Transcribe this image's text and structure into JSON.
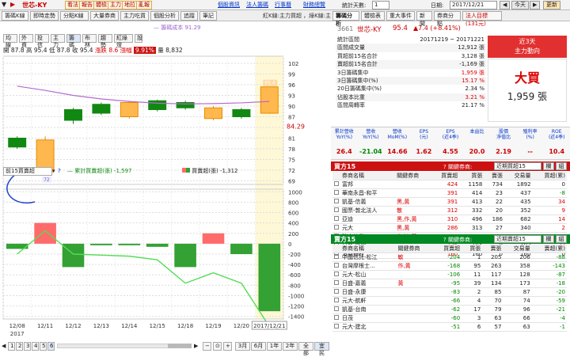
{
  "topbar": {
    "stock": "世芯-KY",
    "buttons": [
      "看法",
      "報告",
      "體檢",
      "主力",
      "地拉",
      "亂報"
    ],
    "links": [
      "個股資訊",
      "法人籌碼",
      "行事曆",
      "財務總覽"
    ],
    "period_label": "統計天數:",
    "period_value": "1",
    "date_label": "日期:",
    "date_value": "2017/12/21",
    "today_btn": "今天",
    "refresh_btn": "更新"
  },
  "left_tabs": [
    "籌碼K線",
    "即時走勢",
    "分點K線",
    "大量券商",
    "主力吃貨",
    "個股分析",
    "追蹤",
    "筆記"
  ],
  "left_note": "紅K線:主力買超 ，綠K線:主力賣超",
  "ind_tabs": [
    "均線",
    "外資",
    "投信",
    "主力",
    "籌碼",
    "布林",
    "趨勢",
    "紅綠燈",
    "設"
  ],
  "ind_active": "籌碼",
  "ohlc": {
    "open_l": "開",
    "open": "87.8",
    "high_l": "高",
    "high": "95.4",
    "low_l": "低",
    "low": "87.8",
    "close_l": "收",
    "close": "95.4",
    "chg_l": "漲跌",
    "chg": "8.6",
    "pct_l": "漲幅",
    "pct": "9.91%",
    "vol_l": "量",
    "vol": "8,832"
  },
  "ma_label": "— 籌碼成本 91.29",
  "price_axis": [
    "102",
    "99",
    "96",
    "93",
    "90",
    "87",
    "84",
    "81",
    "78",
    "75",
    "72",
    "69"
  ],
  "price_axis_vals": [
    102,
    99,
    96,
    93,
    90,
    87,
    84,
    81,
    78,
    75,
    72,
    69
  ],
  "last_price": "84.29",
  "last_tag": "95.4",
  "low_tag": "72",
  "broker_select": "前15買賣超",
  "legend1": "— 累計買賣超(張) -1,597",
  "legend2": "買賣超(張) -1,312",
  "vol_axis": [
    "1000",
    "800",
    "600",
    "400",
    "200",
    "0",
    "-200",
    "-400",
    "-600",
    "-800",
    "-1000",
    "-1200",
    "-1400"
  ],
  "vol_axis_vals": [
    1000,
    800,
    600,
    400,
    200,
    0,
    -200,
    -400,
    -600,
    -800,
    -1000,
    -1200,
    -1400
  ],
  "x_labels": [
    "12/08",
    "12/11",
    "12/12",
    "12/13",
    "12/14",
    "12/15",
    "12/18",
    "12/19",
    "12/20",
    "2017/12/21"
  ],
  "x_year": "2017",
  "bottom_pages": [
    "1",
    "2",
    "3",
    "4",
    "5",
    "6"
  ],
  "bottom_active": "6",
  "bottom_ranges": [
    "3月",
    "6月",
    "1年",
    "2年",
    "全部",
    "宜民"
  ],
  "candles": [
    {
      "o": 78.5,
      "c": 81.0,
      "h": 81.5,
      "l": 78.0,
      "up": false
    },
    {
      "o": 71.5,
      "c": 80.5,
      "h": 81.5,
      "l": 70.5,
      "up": true
    },
    {
      "o": 86.0,
      "c": 89.0,
      "h": 89.5,
      "l": 85.0,
      "up": false
    },
    {
      "o": 90.5,
      "c": 88.0,
      "h": 91.0,
      "l": 87.5,
      "up": false
    },
    {
      "o": 91.0,
      "c": 87.0,
      "h": 91.5,
      "l": 86.5,
      "up": true
    },
    {
      "o": 89.0,
      "c": 91.5,
      "h": 91.8,
      "l": 88.5,
      "up": false
    },
    {
      "o": 89.5,
      "c": 91.0,
      "h": 91.5,
      "l": 89.0,
      "up": false
    },
    {
      "o": 86.5,
      "c": 89.5,
      "h": 90.0,
      "l": 86.0,
      "up": true
    },
    {
      "o": 87.0,
      "c": 89.0,
      "h": 89.5,
      "l": 86.5,
      "up": false
    },
    {
      "o": 88.0,
      "c": 95.4,
      "h": 95.4,
      "l": 87.8,
      "up": true
    }
  ],
  "ma_series": [
    95.6,
    94.4,
    93.0,
    92.0,
    91.3,
    90.8,
    90.6,
    90.7,
    90.9,
    91.3
  ],
  "bars": [
    -100,
    400,
    -450,
    -30,
    -30,
    -60,
    -450,
    200,
    -200,
    -1300
  ],
  "cum_line": [
    -200,
    250,
    -200,
    -220,
    -240,
    -310,
    -760,
    -560,
    -760,
    -1597
  ],
  "right_tabs": [
    "籌碼分析",
    "體檢表",
    "重大事件",
    "新聞",
    "券商分點",
    "法人目標(131元)"
  ],
  "r_stock": {
    "code": "3661",
    "name": "世芯-KY",
    "price": "95.4",
    "chg": "▲7.4 (+8.41%)"
  },
  "stats": [
    {
      "k": "統計區間",
      "v": "20171219 ~ 20171221",
      "cls": ""
    },
    {
      "k": "區間成交量",
      "v": "12,912 張",
      "cls": ""
    },
    {
      "k": "買超前15名合計",
      "v": "3,128 張",
      "cls": ""
    },
    {
      "k": "賣超前15名合計",
      "v": "-1,169 張",
      "cls": ""
    },
    {
      "k": "3日籌碼集中",
      "v": "1,959 張",
      "cls": "red"
    },
    {
      "k": "3日籌碼集中(%)",
      "v": "15.17 %",
      "cls": "red"
    },
    {
      "k": "20日籌碼集中(%)",
      "v": "2.34 %",
      "cls": ""
    },
    {
      "k": "佔股本比重",
      "v": "3.21 %",
      "cls": "red"
    },
    {
      "k": "區間周轉率",
      "v": "21.17 %",
      "cls": ""
    }
  ],
  "trend": {
    "head1": "近3天",
    "head2": "主力動向",
    "big": "大買",
    "amt": "1,959 張"
  },
  "fin_head": [
    "累計營收\nYoY(%)",
    "營收\nYoY(%)",
    "營收\nMoM(%)",
    "EPS\n(元)",
    "EPS\n(近4季)",
    "本益比",
    "股價\n淨值比",
    "殖利率\n(%)",
    "ROE\n(近4季)"
  ],
  "fin_vals": [
    "26.4",
    "-21.04",
    "14.66",
    "1.62",
    "4.55",
    "20.0",
    "2.19",
    "--",
    "10.4"
  ],
  "buy_title": "買方15",
  "buy_rel": "關鍵券商:",
  "buy_sel": "近期買超15",
  "buy_cols": [
    "券商名稱",
    "關鍵券商",
    "買賣超",
    "買張",
    "賣張",
    "交易量",
    "買超(累)"
  ],
  "buy_rows": [
    [
      "富邦",
      "",
      "424",
      "1158",
      "734",
      "1892",
      "0"
    ],
    [
      "華南永昌-和平",
      "",
      "391",
      "414",
      "23",
      "437",
      "-8"
    ],
    [
      "凱基-信義",
      "黑,黃",
      "391",
      "413",
      "22",
      "435",
      "34"
    ],
    [
      "國票-敦北法人",
      "散",
      "312",
      "332",
      "20",
      "352",
      "9"
    ],
    [
      "亞迪",
      "黑,作,黃",
      "310",
      "496",
      "186",
      "682",
      "14"
    ],
    [
      "元大",
      "黑,黃",
      "286",
      "313",
      "27",
      "340",
      "2"
    ],
    [
      "瑞士信貸",
      "作,敏,黃",
      "239",
      "267",
      "28",
      "295",
      "130"
    ],
    [
      "日盛-桃園",
      "",
      "176",
      "184",
      "8",
      "192",
      "32"
    ],
    [
      "港商野村",
      "",
      "160",
      "160",
      "0",
      "160",
      "0"
    ]
  ],
  "sell_title": "賣方15",
  "sell_rel": "關鍵券商:",
  "sell_sel": "近期賣超15",
  "sell_cols": [
    "券商名稱",
    "關鍵券商",
    "買賣超",
    "買張",
    "賣張",
    "交易量",
    "賣超(累)"
  ],
  "sell_rows": [
    [
      "中國信託-松江",
      "敏",
      "-204",
      "1",
      "205",
      "206",
      "-88"
    ],
    [
      "台灣摩根士...",
      "作,黃",
      "-168",
      "95",
      "263",
      "358",
      "-143"
    ],
    [
      "元大-松山",
      "",
      "-106",
      "11",
      "117",
      "128",
      "-87"
    ],
    [
      "日盛-嘉義",
      "黃",
      "-95",
      "39",
      "134",
      "173",
      "-18"
    ],
    [
      "日盛-永康",
      "",
      "-83",
      "2",
      "85",
      "87",
      "-20"
    ],
    [
      "元大-航軒",
      "",
      "-66",
      "4",
      "70",
      "74",
      "-59"
    ],
    [
      "凱基-台南",
      "",
      "-62",
      "17",
      "79",
      "96",
      "-21"
    ],
    [
      "日茂",
      "",
      "-60",
      "3",
      "63",
      "66",
      "-4"
    ],
    [
      "元大-建北",
      "",
      "-51",
      "6",
      "57",
      "63",
      "-1"
    ]
  ],
  "colors": {
    "up": "#ff6b6b",
    "up_fill": "#ffb84d",
    "down": "#118811",
    "red": "#dd0000",
    "green": "#33a133"
  }
}
